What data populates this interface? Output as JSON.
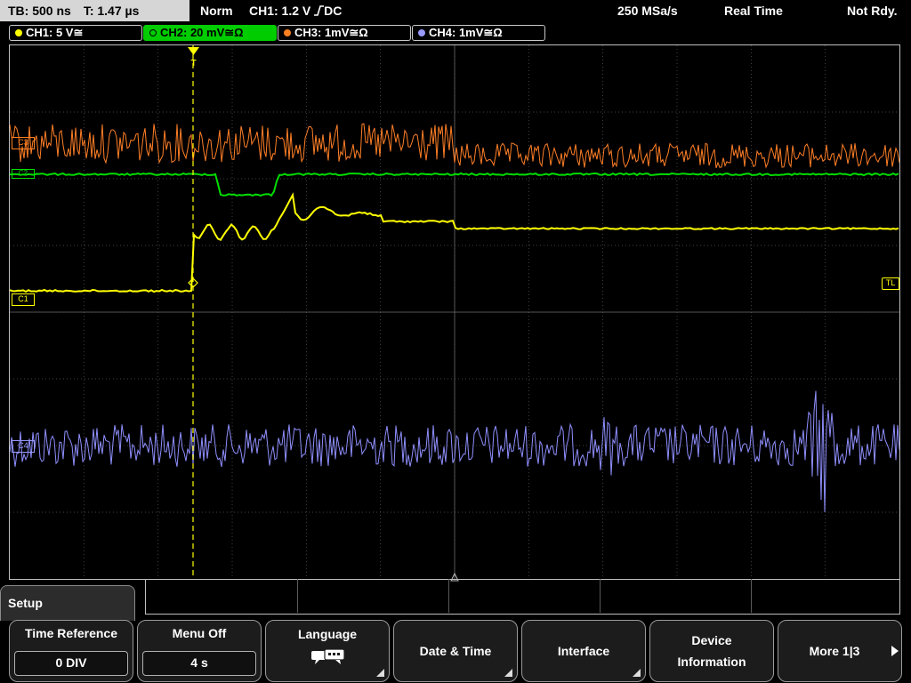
{
  "topbar": {
    "timebase": "TB: 500 ns",
    "trigger_time": "T: 1.47 µs",
    "mode": "Norm",
    "trigger_source": "CH1: 1.2 V",
    "coupling": "DC",
    "sample_rate": "250 MSa/s",
    "acq_mode": "Real Time",
    "status": "Not Rdy."
  },
  "channels": [
    {
      "label": "CH1: 5 V≅",
      "color": "#ffff00",
      "active": false
    },
    {
      "label": "CH2: 20 mV≅Ω",
      "color": "#00dd00",
      "active": true
    },
    {
      "label": "CH3: 1mV≅Ω",
      "color": "#ff8020",
      "active": false
    },
    {
      "label": "CH4: 1mV≅Ω",
      "color": "#9a9aff",
      "active": false
    }
  ],
  "markers": {
    "ch1_ref": "C1",
    "trigger_level": "TL",
    "ch3_ref": "C3",
    "ch2_ref": "C2",
    "ch4_ref": "C4",
    "trigger": "T"
  },
  "menu": {
    "title": "Setup",
    "softkeys": [
      {
        "label": "Time Reference",
        "value": "0 DIV"
      },
      {
        "label": "Menu Off",
        "value": "4 s"
      },
      {
        "label": "Language",
        "icon": "speech-bubbles-icon"
      },
      {
        "label": "Date & Time"
      },
      {
        "label": "Interface"
      },
      {
        "label_line1": "Device",
        "label_line2": "Information"
      },
      {
        "label": "More 1|3"
      }
    ]
  },
  "colors": {
    "ch1": "#ffff00",
    "ch2": "#00dd00",
    "ch3": "#ff7f27",
    "ch4": "#8f8fff",
    "grid": "#5a5a5a",
    "trigger_marker": "#ffff00",
    "active_tab": "#00cc00"
  }
}
